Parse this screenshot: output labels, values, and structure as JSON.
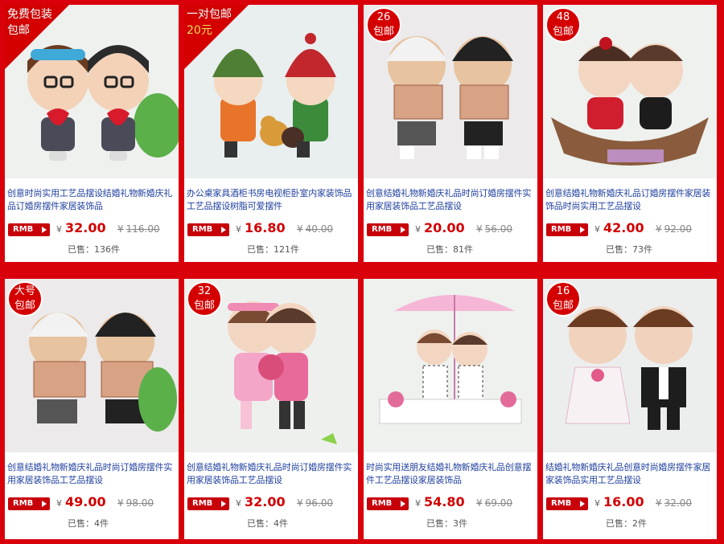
{
  "currency_tag": "RMB",
  "yen": "¥",
  "sold_prefix": "已售：",
  "colors": {
    "background": "#d9000c",
    "badge": "#d40000",
    "title": "#1f3f9e",
    "price": "#d10000"
  },
  "products": [
    {
      "badge_type": "corner",
      "badge": [
        "免费包装",
        "包邮"
      ],
      "title": "创意时尚实用工艺品摆设结婚礼物新婚庆礼品订婚房摆件家居装饰品",
      "price": "32.00",
      "old_price": "116.00",
      "sold": "136件",
      "image": "couple-glasses-hearts-icon"
    },
    {
      "badge_type": "corner",
      "badge": [
        "一对包邮",
        "20元"
      ],
      "title": "办公桌家具酒柜书房电视柜卧室内家装饰品工艺品摆设树脂可爱摆件",
      "price": "16.80",
      "old_price": "40.00",
      "sold": "121件",
      "image": "kids-knit-hats-dogs-icon"
    },
    {
      "badge_type": "circle",
      "badge": [
        "26",
        "包邮"
      ],
      "title": "创意结婚礼物新婚庆礼品时尚订婚房摆件实用家居装饰品工艺品摆设",
      "price": "20.00",
      "old_price": "56.00",
      "sold": "81件",
      "image": "couple-tickets-icon"
    },
    {
      "badge_type": "circle",
      "badge": [
        "48",
        "包邮"
      ],
      "title": "创意结婚礼物新婚庆礼品订婚房摆件家居装饰品时尚实用工艺品摆设",
      "price": "42.00",
      "old_price": "92.00",
      "sold": "73件",
      "image": "couple-boat-icon"
    },
    {
      "badge_type": "circle",
      "badge": [
        "大号",
        "包邮"
      ],
      "title": "创意结婚礼物新婚庆礼品时尚订婚房摆件实用家居装饰品工艺品摆设",
      "price": "49.00",
      "old_price": "98.00",
      "sold": "4件",
      "image": "couple-tickets-large-icon"
    },
    {
      "badge_type": "circle",
      "badge": [
        "32",
        "包邮"
      ],
      "title": "创意结婚礼物新婚庆礼品时尚订婚房摆件实用家居装饰品工艺品摆设",
      "price": "32.00",
      "old_price": "96.00",
      "sold": "4件",
      "image": "couple-flowers-icon"
    },
    {
      "badge_type": "none",
      "badge": [],
      "title": "时尚实用送朋友结婚礼物新婚庆礼品创意摆件工艺品摆设家居装饰品",
      "price": "54.80",
      "old_price": "69.00",
      "sold": "3件",
      "image": "couple-umbrella-icon"
    },
    {
      "badge_type": "circle",
      "badge": [
        "16",
        "包邮"
      ],
      "title": "结婚礼物新婚庆礼品创意时尚婚房摆件家居家装饰品实用工艺品摆设",
      "price": "16.00",
      "old_price": "32.00",
      "sold": "2件",
      "image": "bride-groom-icon"
    }
  ]
}
